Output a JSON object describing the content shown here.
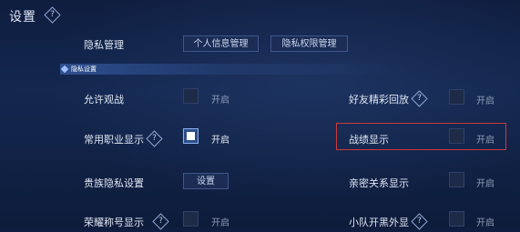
{
  "header": {
    "title": "设置",
    "help_icon": "?"
  },
  "privacy": {
    "label": "隐私管理",
    "buttons": [
      "个人信息管理",
      "隐私权限管理"
    ]
  },
  "section": {
    "title": "隐私设置"
  },
  "settings": {
    "allow_spectate": {
      "label": "允许观战",
      "toggle_text": "开启",
      "checked": false
    },
    "friend_replay": {
      "label": "好友精彩回放",
      "toggle_text": "开启",
      "checked": false
    },
    "common_role": {
      "label": "常用职业显示",
      "toggle_text": "开启",
      "checked": true
    },
    "combat_record": {
      "label": "战绩显示",
      "toggle_text": "开启",
      "checked": false
    },
    "noble_privacy": {
      "label": "贵族隐私设置",
      "button": "设置"
    },
    "intimate_relation": {
      "label": "亲密关系显示",
      "toggle_text": "开启",
      "checked": false
    },
    "honor_title": {
      "label": "荣耀称号显示",
      "toggle_text": "开启",
      "checked": false
    },
    "team_skin": {
      "label": "小队开黑外显",
      "toggle_text": "开启",
      "checked": false
    }
  },
  "colors": {
    "highlight": "#c93a3a",
    "background": "#13274f",
    "accent": "#2c4d8c"
  }
}
